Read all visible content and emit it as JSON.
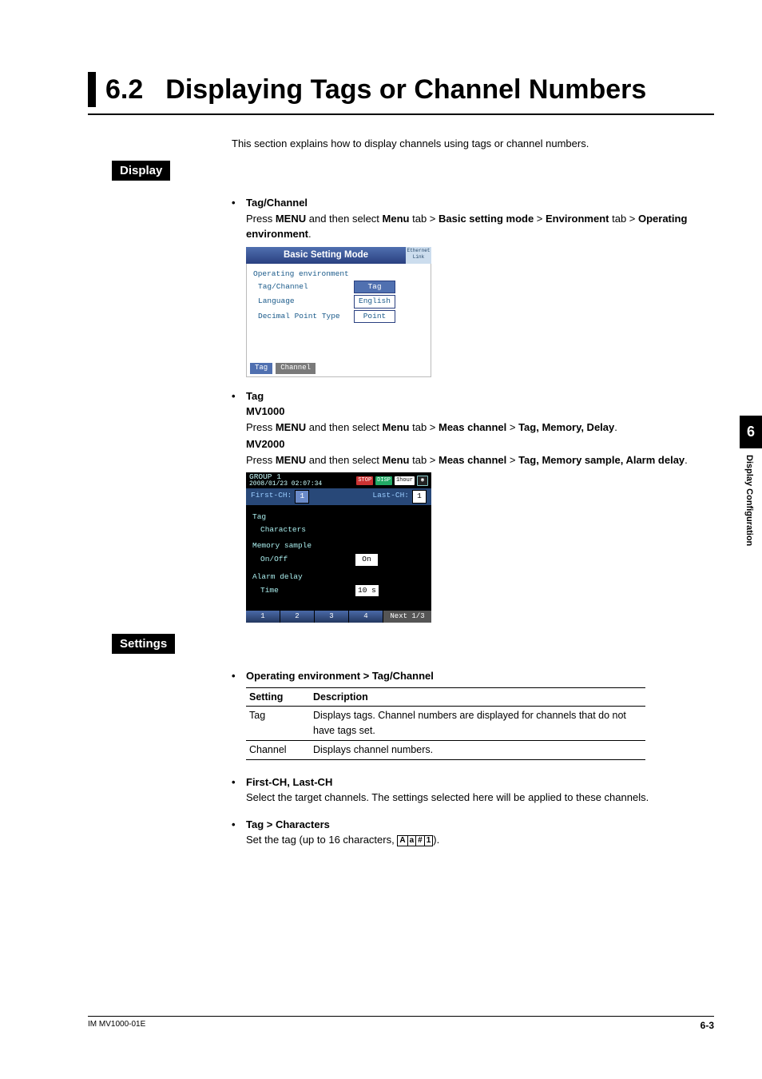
{
  "header": {
    "number": "6.2",
    "title": "Displaying Tags or Channel Numbers"
  },
  "intro": "This section explains how to display channels using tags or channel numbers.",
  "labels": {
    "display": "Display",
    "settings": "Settings"
  },
  "display": {
    "tagChannel": {
      "heading": "Tag/Channel",
      "line_prefix": "Press ",
      "menu1": "MENU",
      "mid1": " and then select ",
      "menu2": "Menu",
      "mid2": " tab > ",
      "bsm": "Basic setting mode",
      "mid3": " > ",
      "env": "Environment",
      "mid4": " tab > ",
      "opEnvBold": "Operating environment",
      "period": "."
    },
    "tag": {
      "heading": "Tag",
      "mv1000": "MV1000",
      "mv1000_line_prefix": "Press ",
      "mv1000_menu1": "MENU",
      "mv1000_mid1": " and then select ",
      "mv1000_menu2": "Menu",
      "mv1000_mid2": " tab > ",
      "mv1000_meas": "Meas channel",
      "mv1000_mid3": " > ",
      "mv1000_end": "Tag, Memory, Delay",
      "mv1000_period": ".",
      "mv2000": "MV2000",
      "mv2000_line_prefix": "Press ",
      "mv2000_menu1": "MENU",
      "mv2000_mid1": " and then select ",
      "mv2000_menu2": "Menu",
      "mv2000_mid2": " tab > ",
      "mv2000_meas": "Meas channel",
      "mv2000_mid3": " > ",
      "mv2000_end": "Tag, Memory sample, Alarm delay",
      "mv2000_period": "."
    }
  },
  "shot1": {
    "title": "Basic Setting Mode",
    "eth": "Ethernet Link",
    "heading": "Operating environment",
    "rows": [
      {
        "label": "Tag/Channel",
        "value": "Tag",
        "sel": true
      },
      {
        "label": "Language",
        "value": "English",
        "sel": false
      },
      {
        "label": "Decimal Point Type",
        "value": "Point",
        "sel": false
      }
    ],
    "tabs": [
      "Tag",
      "Channel"
    ]
  },
  "shot2": {
    "group": "GROUP 1",
    "datetime": "2008/01/23 02:07:34",
    "stopBadge": "STOP",
    "dispBadge": "DISP",
    "timeBadge": "1hour",
    "firstCh": "First-CH:",
    "firstChVal": "1",
    "lastCh": "Last-CH:",
    "lastChVal": "1",
    "sections": {
      "tag": "Tag",
      "characters": "Characters",
      "memory": "Memory sample",
      "onoff": "On/Off",
      "onoffVal": "On",
      "alarm": "Alarm delay",
      "time": "Time",
      "timeVal": "10 s"
    },
    "footerTabs": [
      "1",
      "2",
      "3",
      "4"
    ],
    "next": "Next 1/3"
  },
  "settings": {
    "opEnvHeading": "Operating environment > Tag/Channel",
    "table": {
      "colSetting": "Setting",
      "colDescription": "Description",
      "rows": [
        {
          "setting": "Tag",
          "desc": "Displays tags. Channel numbers are displayed for channels that do not have tags set."
        },
        {
          "setting": "Channel",
          "desc": "Displays channel numbers."
        }
      ]
    },
    "firstLast": {
      "heading": "First-CH, Last-CH",
      "body": "Select the target channels. The settings selected here will be applied to these channels."
    },
    "tagChars": {
      "heading": "Tag > Characters",
      "body_prefix": "Set the tag (up to 16 characters, ",
      "body_suffix": ").",
      "iconChars": [
        "A",
        "a",
        "#",
        "1"
      ]
    }
  },
  "rightTab": {
    "chapter": "6",
    "label": "Display Configuration"
  },
  "footer": {
    "left": "IM MV1000-01E",
    "right": "6-3"
  }
}
